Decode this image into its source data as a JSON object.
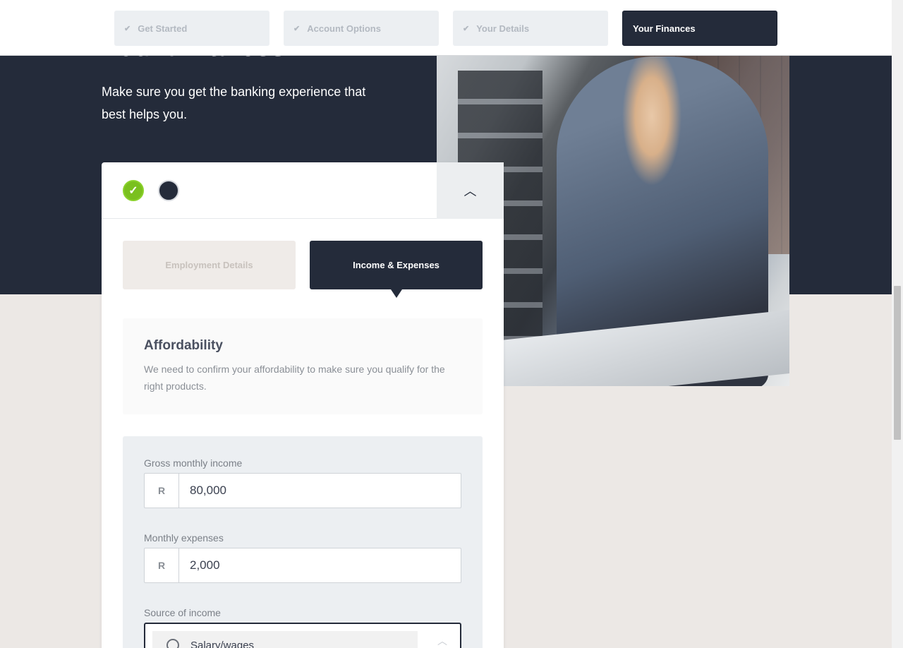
{
  "steps": [
    {
      "label": "Get Started",
      "done": true
    },
    {
      "label": "Account Options",
      "done": true
    },
    {
      "label": "Your Details",
      "done": true
    },
    {
      "label": "Your Finances",
      "done": false,
      "active": true
    }
  ],
  "hero": {
    "title": "Your Finances",
    "subtitle": "Make sure you get the banking experience that best helps you."
  },
  "card": {
    "tabs": [
      {
        "label": "Employment Details",
        "active": false
      },
      {
        "label": "Income & Expenses",
        "active": true
      }
    ],
    "affordability": {
      "title": "Affordability",
      "description": "We need to confirm your affordability to make sure you qualify for the right products."
    },
    "fields": {
      "gross_income": {
        "label": "Gross monthly income",
        "prefix": "R",
        "value": "80,000"
      },
      "expenses": {
        "label": "Monthly expenses",
        "prefix": "R",
        "value": "2,000"
      },
      "source": {
        "label": "Source of income",
        "option": "Salary/wages"
      }
    }
  },
  "icons": {
    "step_check": "check-icon",
    "collapse": "chevron-up-icon",
    "progress_done": "check-circle-icon"
  },
  "colors": {
    "navy": "#242b3a",
    "success": "#7ac01e",
    "background": "#ece8e5"
  }
}
